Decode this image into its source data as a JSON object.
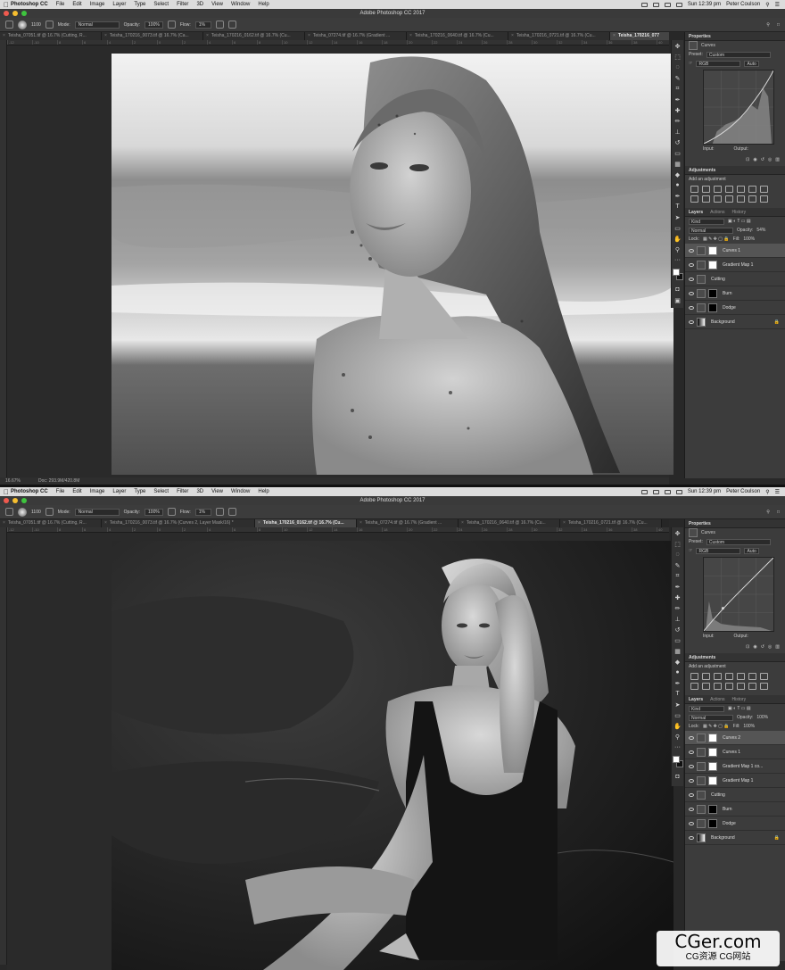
{
  "menubar": {
    "app": "Photoshop CC",
    "items": [
      "File",
      "Edit",
      "Image",
      "Layer",
      "Type",
      "Select",
      "Filter",
      "3D",
      "View",
      "Window",
      "Help"
    ],
    "clock": "Sun 12:39 pm",
    "user": "Peter Coulson"
  },
  "window_title": "Adobe Photoshop CC 2017",
  "options": {
    "brush_size": "1100",
    "mode_label": "Mode:",
    "mode_value": "Normal",
    "opacity_label": "Opacity:",
    "opacity_value": "100%",
    "flow_label": "Flow:",
    "flow_value": "1%"
  },
  "ruler_ticks": [
    "-12",
    "-10",
    "8",
    "6",
    "4",
    "2",
    "0",
    "2",
    "4",
    "6",
    "8",
    "10",
    "12",
    "14",
    "16",
    "18",
    "20",
    "22",
    "24",
    "26",
    "28",
    "30",
    "32",
    "34",
    "36",
    "38",
    "40",
    "42",
    "44",
    "46",
    "48",
    "50"
  ],
  "screen1": {
    "tabs": [
      {
        "label": "Teisha_07051.tif @ 16.7% (Cutting, R...",
        "active": false
      },
      {
        "label": "Teisha_170216_0073.tif @ 16.7% (Ca...",
        "active": false
      },
      {
        "label": "Teisha_170216_0162.tif @ 16.7% (Cu...",
        "active": false
      },
      {
        "label": "Teisha_07274.tif @ 16.7% (Gradient ...",
        "active": false
      },
      {
        "label": "Teisha_170216_0640.tif @ 16.7% (Cu...",
        "active": false
      },
      {
        "label": "Teisha_170216_0721.tif @ 16.7% (Cu...",
        "active": false
      },
      {
        "label": "Teisha_170216_077",
        "active": true
      }
    ],
    "status_zoom": "16.67%",
    "status_doc": "Doc: 293.9M/420.8M",
    "properties": {
      "title": "Properties",
      "adjustment": "Curves",
      "preset_label": "Preset:",
      "preset_value": "Custom",
      "channel": "RGB",
      "auto": "Auto",
      "input_label": "Input:",
      "output_label": "Output:"
    },
    "adjustments": {
      "title": "Adjustments",
      "subtitle": "Add an adjustment"
    },
    "layers_panel": {
      "tabs": [
        "Layers",
        "Actions",
        "History"
      ],
      "kind": "Kind",
      "blend": "Normal",
      "opacity_label": "Opacity:",
      "opacity_value": "54%",
      "lock_label": "Lock:",
      "fill_label": "Fill:",
      "fill_value": "100%",
      "layers": [
        {
          "name": "Curves 1",
          "thumb": "w",
          "selected": true
        },
        {
          "name": "Gradient Map 1",
          "thumb": "w",
          "selected": false
        },
        {
          "name": "Cutting",
          "thumb": "m",
          "selected": false
        },
        {
          "name": "Burn",
          "thumb": "b",
          "selected": false
        },
        {
          "name": "Dodge",
          "thumb": "b",
          "selected": false
        },
        {
          "name": "Background",
          "thumb": "g",
          "selected": false
        }
      ]
    }
  },
  "screen2": {
    "tabs": [
      {
        "label": "Teisha_07051.tif @ 16.7% (Cutting, R...",
        "active": false
      },
      {
        "label": "Teisha_170216_0073.tif @ 16.7% (Curves 2, Layer Mask/16) *",
        "active": false
      },
      {
        "label": "Teisha_170216_0162.tif @ 16.7% (Cu...",
        "active": true
      },
      {
        "label": "Teisha_07274.tif @ 16.7% (Gradient ...",
        "active": false
      },
      {
        "label": "Teisha_170216_0640.tif @ 16.7% (Cu...",
        "active": false
      },
      {
        "label": "Teisha_170216_0721.tif @ 16.7% (Cu...",
        "active": false
      }
    ],
    "properties": {
      "title": "Properties",
      "adjustment": "Curves",
      "preset_label": "Preset:",
      "preset_value": "Custom",
      "channel": "RGB",
      "auto": "Auto",
      "input_label": "Input:",
      "output_label": "Output:"
    },
    "adjustments": {
      "title": "Adjustments",
      "subtitle": "Add an adjustment"
    },
    "layers_panel": {
      "tabs": [
        "Layers",
        "Actions",
        "History"
      ],
      "kind": "Kind",
      "blend": "Normal",
      "opacity_label": "Opacity:",
      "opacity_value": "100%",
      "lock_label": "Lock:",
      "fill_label": "Fill:",
      "fill_value": "100%",
      "layers": [
        {
          "name": "Curves 2",
          "thumb": "w",
          "selected": true
        },
        {
          "name": "Curves 1",
          "thumb": "w",
          "selected": false
        },
        {
          "name": "Gradient Map 1 co...",
          "thumb": "w",
          "selected": false
        },
        {
          "name": "Gradient Map 1",
          "thumb": "w",
          "selected": false
        },
        {
          "name": "Cutting",
          "thumb": "m",
          "selected": false
        },
        {
          "name": "Burn",
          "thumb": "b",
          "selected": false
        },
        {
          "name": "Dodge",
          "thumb": "b",
          "selected": false
        },
        {
          "name": "Background",
          "thumb": "g",
          "selected": false
        }
      ]
    }
  },
  "watermark": {
    "main": "CGer.com",
    "sub": "CG资源 CG网站"
  }
}
